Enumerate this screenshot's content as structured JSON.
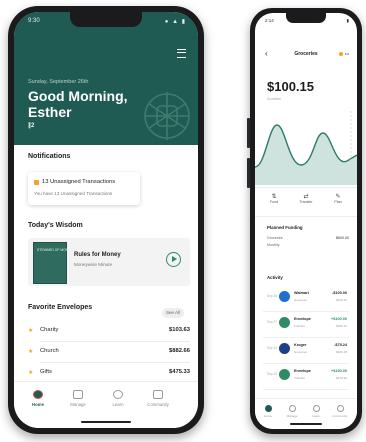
{
  "left": {
    "status": {
      "time": "9:30",
      "icons": "● ▲ ▮"
    },
    "hero": {
      "date": "Sunday, September 26th",
      "greeting": "Good Morning, Esther",
      "badge": "∥2"
    },
    "notifications": {
      "title": "Notifications",
      "card_title": "13 Unassigned Transactions",
      "card_sub": "You have 13 Unassigned Transactions"
    },
    "wisdom": {
      "title": "Today's Wisdom",
      "book_cover": "STEWARD OF MONEY IS",
      "item_title": "Rules for Money",
      "item_sub": "Moneywise Minute"
    },
    "envelopes": {
      "title": "Favorite Envelopes",
      "see_all": "See All",
      "items": [
        {
          "name": "Charity",
          "amount": "$103.63"
        },
        {
          "name": "Church",
          "amount": "$882.66"
        },
        {
          "name": "Gifts",
          "amount": "$475.33"
        }
      ]
    },
    "tabs": [
      "Home",
      "Manage",
      "Learn",
      "Community"
    ]
  },
  "right": {
    "status": {
      "time": "2:14",
      "icons": "▮"
    },
    "header": {
      "back": "‹",
      "title": "Groceries",
      "pill": "•••"
    },
    "balance": "$100.15",
    "balance_sub": "Available",
    "actions": [
      {
        "glyph": "⇅",
        "label": "Fund"
      },
      {
        "glyph": "⇄",
        "label": "Transfer"
      },
      {
        "glyph": "✎",
        "label": "Plan"
      }
    ],
    "planned_funding": {
      "title": "Planned Funding",
      "row_label": "Groceries",
      "row_sub": "Monthly",
      "row_value": "$600.00"
    },
    "activity": {
      "title": "Activity",
      "transactions": [
        {
          "date": "Sep 28",
          "name": "Walmart",
          "sub": "Groceries",
          "amount": "-$100.00",
          "balance": "$100.15",
          "color": "#1f6fd1",
          "amount_color": "#222222"
        },
        {
          "date": "Sep 27",
          "name": "Envelope",
          "sub": "Transfer",
          "amount": "+$100.00",
          "balance": "$200.15",
          "color": "#2e8b67",
          "amount_color": "#2e8b67"
        },
        {
          "date": "Sep 24",
          "name": "Kroger",
          "sub": "Groceries",
          "amount": "-$75.24",
          "balance": "$100.15",
          "color": "#1c3f8c",
          "amount_color": "#222222"
        },
        {
          "date": "Sep 22",
          "name": "Envelope",
          "sub": "Transfer",
          "amount": "+$150.00",
          "balance": "$175.39",
          "color": "#2e8b67",
          "amount_color": "#2e8b67"
        }
      ]
    },
    "tabs": [
      "Home",
      "Manage",
      "Learn",
      "Community"
    ]
  },
  "colors": {
    "brand_green": "#1f5b52",
    "accent_orange": "#f2a622",
    "positive": "#2e8b67"
  }
}
